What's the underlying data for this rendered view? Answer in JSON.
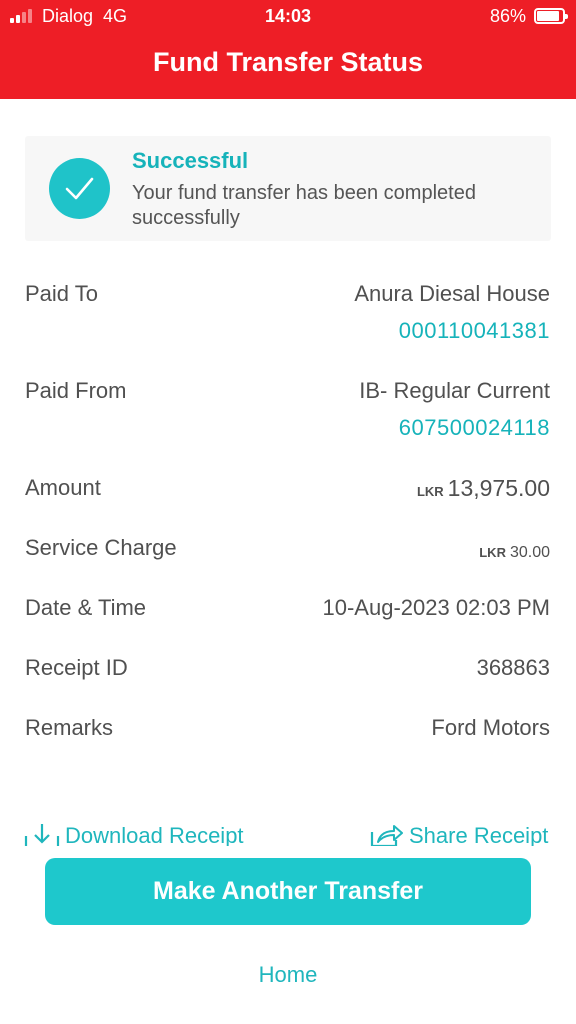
{
  "status_bar": {
    "carrier": "Dialog  4G",
    "time": "14:03",
    "battery": "86%"
  },
  "header": {
    "title": "Fund Transfer Status"
  },
  "status": {
    "title": "Successful",
    "message": "Your fund transfer has been completed successfully"
  },
  "details": {
    "paid_to": {
      "label": "Paid To",
      "name": "Anura Diesal House",
      "account": "000110041381"
    },
    "paid_from": {
      "label": "Paid From",
      "name": "IB- Regular Current",
      "account": "607500024118"
    },
    "amount": {
      "label": "Amount",
      "currency": "LKR",
      "value": "13,975.00"
    },
    "service_charge": {
      "label": "Service Charge",
      "currency": "LKR",
      "value": "30.00"
    },
    "date_time": {
      "label": "Date & Time",
      "value": "10-Aug-2023 02:03 PM"
    },
    "receipt_id": {
      "label": "Receipt ID",
      "value": "368863"
    },
    "remarks": {
      "label": "Remarks",
      "value": "Ford Motors"
    }
  },
  "actions": {
    "download": "Download Receipt",
    "share": "Share Receipt",
    "primary": "Make Another Transfer",
    "home": "Home"
  },
  "colors": {
    "header": "#ee1e26",
    "accent": "#1ec8cc",
    "link": "#16b3ba"
  }
}
